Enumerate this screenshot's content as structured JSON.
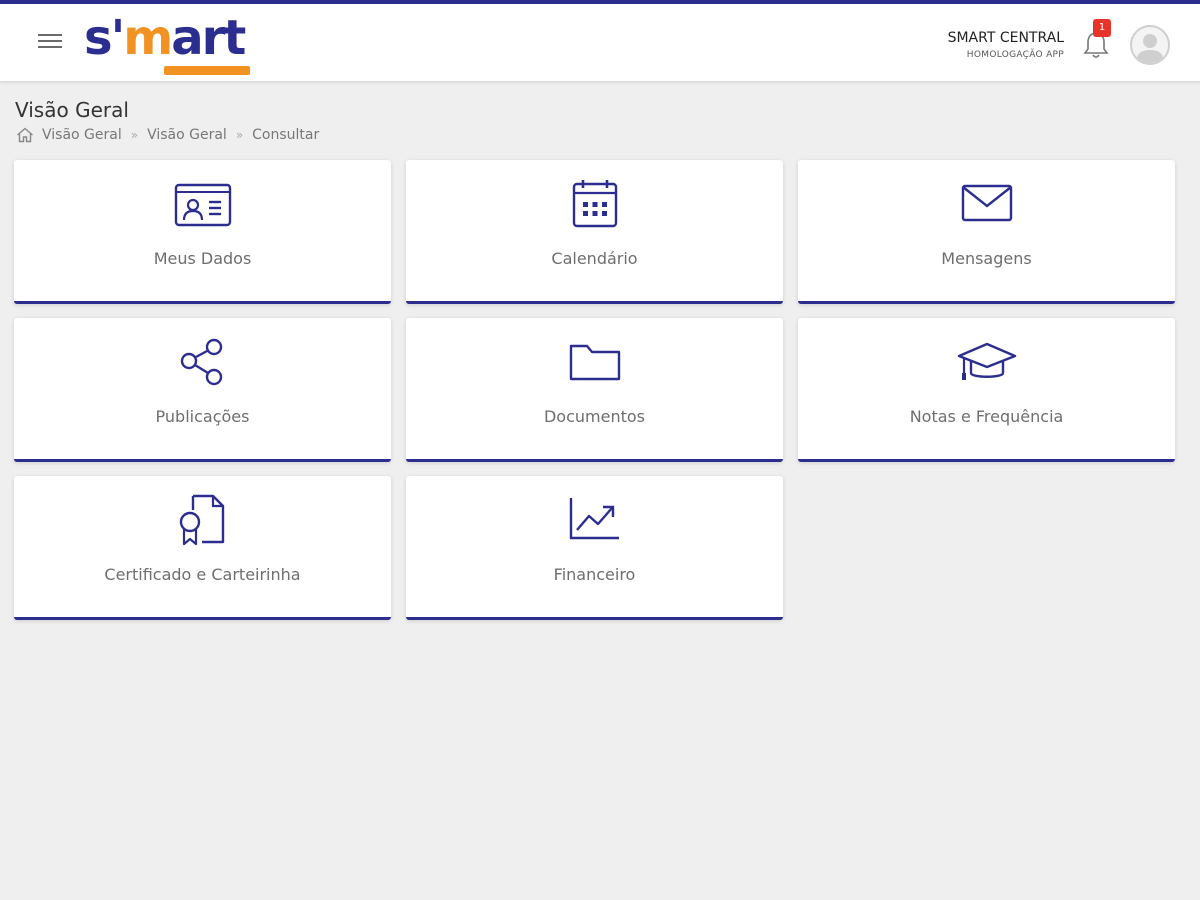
{
  "header": {
    "logo_text_s": "s'",
    "logo_text_m": "m",
    "logo_text_rest": "art",
    "user_name": "SMART CENTRAL",
    "user_subtitle": "HOMOLOGAÇÃO APP",
    "notification_count": "1",
    "icons": [
      "menu-icon",
      "bell-icon",
      "user-avatar-icon"
    ]
  },
  "page": {
    "title": "Visão Geral",
    "breadcrumb": [
      "Visão Geral",
      "Visão Geral",
      "Consultar"
    ]
  },
  "cards": [
    {
      "label": "Meus Dados",
      "icon": "id-card-icon"
    },
    {
      "label": "Calendário",
      "icon": "calendar-icon"
    },
    {
      "label": "Mensagens",
      "icon": "envelope-icon"
    },
    {
      "label": "Publicações",
      "icon": "share-icon"
    },
    {
      "label": "Documentos",
      "icon": "folder-icon"
    },
    {
      "label": "Notas e Frequência",
      "icon": "graduation-cap-icon"
    },
    {
      "label": "Certificado e Carteirinha",
      "icon": "certificate-icon"
    },
    {
      "label": "Financeiro",
      "icon": "trend-chart-icon"
    }
  ],
  "colors": {
    "primary": "#2b2e8f",
    "accent": "#f29222",
    "background": "#efefef",
    "badge": "#e8332a"
  }
}
